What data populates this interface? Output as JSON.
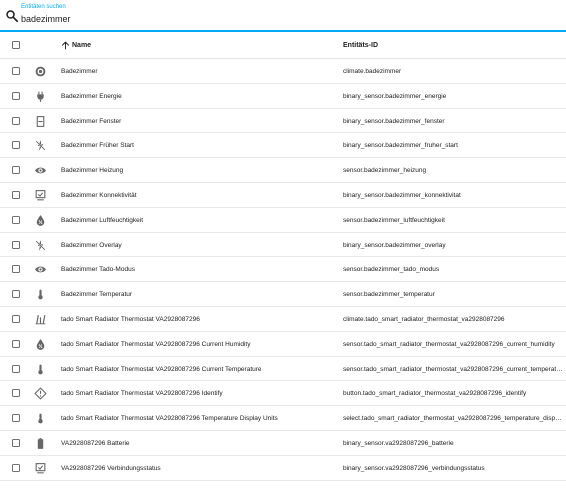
{
  "search": {
    "label": "Entitäten suchen",
    "value": "badezimmer"
  },
  "table": {
    "columns": {
      "name": "Name",
      "id": "Entitäts-ID"
    },
    "rows": [
      {
        "icon": "thermostat-icon",
        "name": "Badezimmer",
        "id": "climate.badezimmer"
      },
      {
        "icon": "power-plug-icon",
        "name": "Badezimmer Energie",
        "id": "binary_sensor.badezimmer_energie"
      },
      {
        "icon": "window-icon",
        "name": "Badezimmer Fenster",
        "id": "binary_sensor.badezimmer_fenster"
      },
      {
        "icon": "flash-off-icon",
        "name": "Badezimmer Früher Start",
        "id": "binary_sensor.badezimmer_fruher_start"
      },
      {
        "icon": "eye-icon",
        "name": "Badezimmer Heizung",
        "id": "sensor.badezimmer_heizung"
      },
      {
        "icon": "monitor-check-icon",
        "name": "Badezimmer Konnektivität",
        "id": "binary_sensor.badezimmer_konnektivitat"
      },
      {
        "icon": "water-percent-icon",
        "name": "Badezimmer Luftfeuchtigkeit",
        "id": "sensor.badezimmer_luftfeuchtigkeit"
      },
      {
        "icon": "flash-off-icon",
        "name": "Badezimmer Overlay",
        "id": "binary_sensor.badezimmer_overlay"
      },
      {
        "icon": "eye-icon",
        "name": "Badezimmer Tado-Modus",
        "id": "sensor.badezimmer_tado_modus"
      },
      {
        "icon": "thermometer-icon",
        "name": "Badezimmer Temperatur",
        "id": "sensor.badezimmer_temperatur"
      },
      {
        "icon": "radiator-icon",
        "name": "tado Smart Radiator Thermostat VA2928087296",
        "id": "climate.tado_smart_radiator_thermostat_va2928087296"
      },
      {
        "icon": "water-percent-icon",
        "name": "tado Smart Radiator Thermostat VA2928087296 Current Humidity",
        "id": "sensor.tado_smart_radiator_thermostat_va2928087296_current_humidity"
      },
      {
        "icon": "thermometer-icon",
        "name": "tado Smart Radiator Thermostat VA2928087296 Current Temperature",
        "id": "sensor.tado_smart_radiator_thermostat_va2928087296_current_temperature"
      },
      {
        "icon": "alert-icon",
        "name": "tado Smart Radiator Thermostat VA2928087296 Identify",
        "id": "button.tado_smart_radiator_thermostat_va2928087296_identify"
      },
      {
        "icon": "thermometer-icon",
        "name": "tado Smart Radiator Thermostat VA2928087296 Temperature Display Units",
        "id": "select.tado_smart_radiator_thermostat_va2928087296_temperature_displa..."
      },
      {
        "icon": "battery-icon",
        "name": "VA2928087296 Batterie",
        "id": "binary_sensor.va2928087296_batterie"
      },
      {
        "icon": "monitor-check-icon",
        "name": "VA2928087296 Verbindungsstatus",
        "id": "binary_sensor.va2928087296_verbindungsstatus"
      }
    ]
  }
}
